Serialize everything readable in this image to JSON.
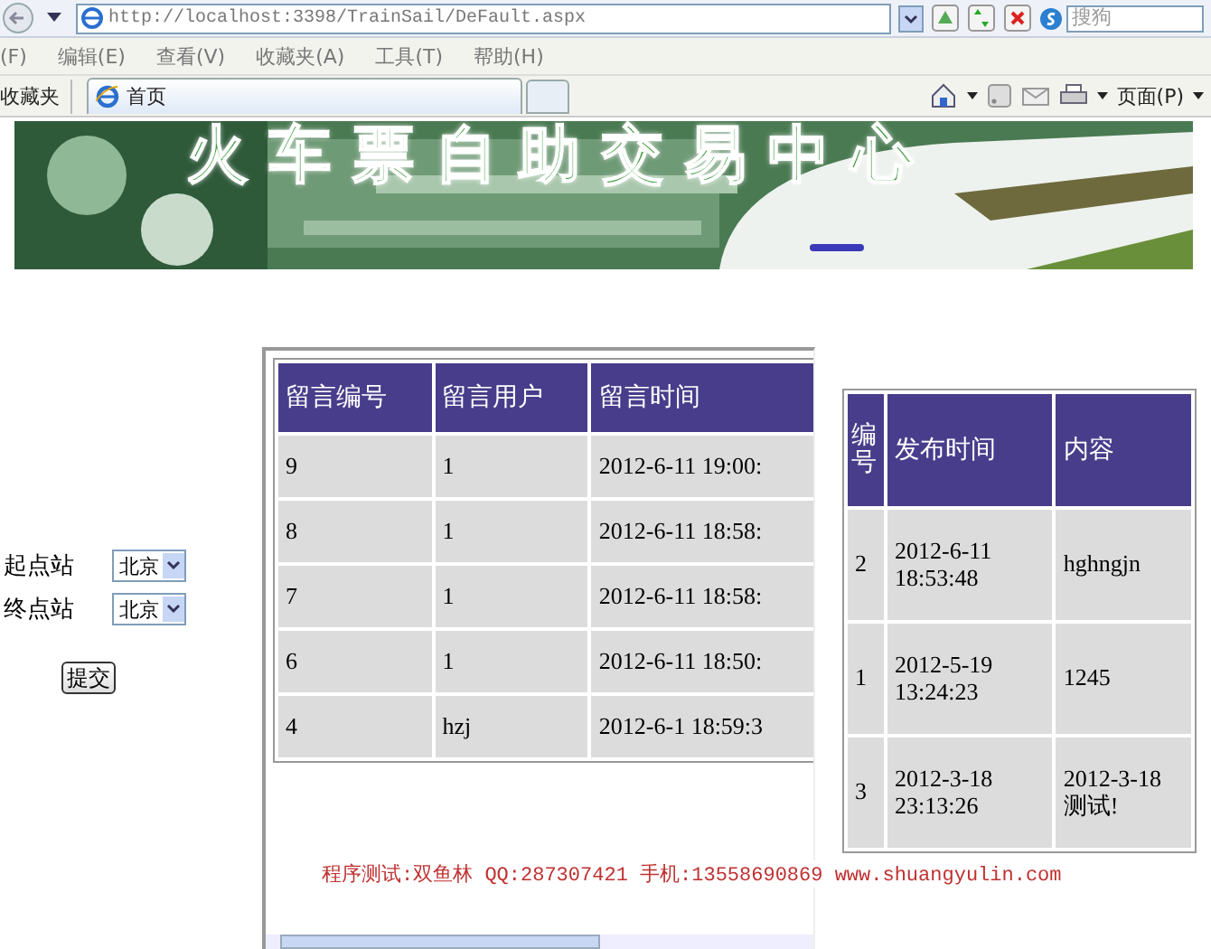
{
  "browser": {
    "address": "http://localhost:3398/TrainSail/DeFault.aspx",
    "search_placeholder": "搜狗",
    "menu": [
      "(F)",
      "编辑(E)",
      "查看(V)",
      "收藏夹(A)",
      "工具(T)",
      "帮助(H)"
    ],
    "favorites": "收藏夹",
    "tabs": [
      {
        "label": "首页",
        "selected": true
      }
    ],
    "page_menu": "页面(P)"
  },
  "banner": {
    "title": "火车票自助交易中心"
  },
  "search_form": {
    "fields": [
      {
        "label": "起点站",
        "value": "北京"
      },
      {
        "label": "终点站",
        "value": "北京"
      }
    ],
    "submit": "提交"
  },
  "messages": {
    "columns": [
      "留言编号",
      "留言用户",
      "留言时间"
    ],
    "rows": [
      [
        "9",
        "1",
        "2012-6-11 19:00:"
      ],
      [
        "8",
        "1",
        "2012-6-11 18:58:"
      ],
      [
        "7",
        "1",
        "2012-6-11 18:58:"
      ],
      [
        "6",
        "1",
        "2012-6-11 18:50:"
      ],
      [
        "4",
        "hzj",
        "2012-6-1 18:59:3"
      ]
    ]
  },
  "footer": "程序测试:双鱼林 QQ:287307421 手机:13558690869 www.shuangyulin.com",
  "notices": {
    "columns": [
      "编号",
      "发布时间",
      "内容"
    ],
    "rows": [
      [
        "2",
        "2012-6-11 18:53:48",
        "hghngjn"
      ],
      [
        "1",
        "2012-5-19 13:24:23",
        "1245"
      ],
      [
        "3",
        "2012-3-18 23:13:26",
        "2012-3-18测试!"
      ]
    ]
  }
}
